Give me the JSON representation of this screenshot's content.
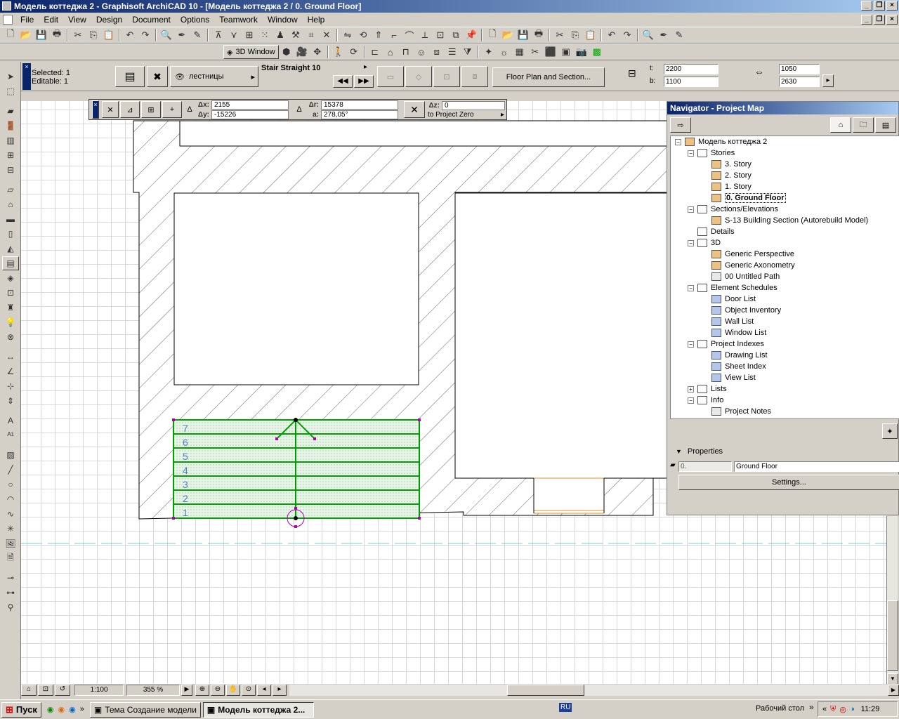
{
  "window": {
    "title": "Модель коттеджа 2 - Graphisoft ArchiCAD 10 - [Модель коттеджа 2 / 0. Ground Floor]",
    "minimize_icon": "minimize-icon",
    "restore_icon": "restore-icon",
    "close_icon": "close-icon"
  },
  "menu": [
    "File",
    "Edit",
    "View",
    "Design",
    "Document",
    "Options",
    "Teamwork",
    "Window",
    "Help"
  ],
  "toolbar2": {
    "window3d_label": "3D Window"
  },
  "infobox": {
    "selected": "Selected: 1",
    "editable": "Editable: 1",
    "layer": "лестницы",
    "stair_name": "Stair Straight 10",
    "floor_plan_button": "Floor Plan and Section...",
    "t_label": "t:",
    "t_value": "2200",
    "b_label": "b:",
    "b_value": "1100",
    "width_value": "1050",
    "height_value": "2630"
  },
  "coordbox": {
    "dx_label": "Δx:",
    "dx": "2155",
    "dy_label": "Δy:",
    "dy": "-15226",
    "dr_label": "Δr:",
    "dr": "15378",
    "a_label": "a:",
    "a": "278,05°",
    "dz_label": "Δz:",
    "dz": "0",
    "reference": "to Project Zero"
  },
  "stair": {
    "riser_numbers": [
      "7",
      "6",
      "5",
      "4",
      "3",
      "2",
      "1"
    ],
    "color": "#00a000"
  },
  "navigator": {
    "title": "Navigator - Project Map",
    "project": "Модель коттеджа 2",
    "stories_label": "Stories",
    "stories": [
      "3. Story",
      "2. Story",
      "1. Story",
      "0. Ground Floor"
    ],
    "sections_label": "Sections/Elevations",
    "section_item": "S-13 Building Section (Autorebuild Model)",
    "details_label": "Details",
    "label_3d": "3D",
    "items_3d": [
      "Generic Perspective",
      "Generic Axonometry",
      "00 Untitled Path"
    ],
    "schedules_label": "Element Schedules",
    "schedules": [
      "Door List",
      "Object Inventory",
      "Wall List",
      "Window List"
    ],
    "indexes_label": "Project Indexes",
    "indexes": [
      "Drawing List",
      "Sheet Index",
      "View List"
    ],
    "lists_label": "Lists",
    "info_label": "Info",
    "info_items": [
      "Project Notes"
    ],
    "properties_label": "Properties",
    "prop_number": "0.",
    "prop_name": "Ground Floor",
    "settings_button": "Settings..."
  },
  "statusbar": {
    "scale": "1:100",
    "zoom": "355 %"
  },
  "taskbar": {
    "start": "Пуск",
    "task1": "Тема Создание модели ...",
    "task2": "Модель коттеджа 2...",
    "language": "RU",
    "desktop": "Рабочий стол",
    "time": "11:29"
  }
}
